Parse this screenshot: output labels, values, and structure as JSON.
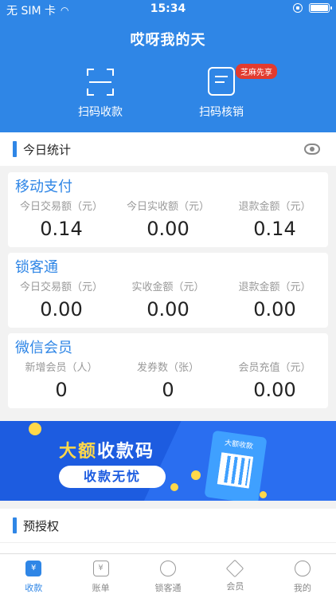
{
  "status": {
    "carrier": "无 SIM 卡",
    "time": "15:34",
    "battery_level": 0.9
  },
  "app_title": "哎呀我的天",
  "actions": {
    "scan_label": "扫码收款",
    "verify_label": "扫码核销",
    "verify_badge": "芝麻先享"
  },
  "today": {
    "header": "今日统计",
    "cards": [
      {
        "title": "移动支付",
        "cols": [
          {
            "label": "今日交易额（元）",
            "value": "0.14"
          },
          {
            "label": "今日实收额（元）",
            "value": "0.00"
          },
          {
            "label": "退款金额（元）",
            "value": "0.14"
          }
        ]
      },
      {
        "title": "锁客通",
        "cols": [
          {
            "label": "今日交易额（元）",
            "value": "0.00"
          },
          {
            "label": "实收金额（元）",
            "value": "0.00"
          },
          {
            "label": "退款金额（元）",
            "value": "0.00"
          }
        ]
      },
      {
        "title": "微信会员",
        "cols": [
          {
            "label": "新增会员（人）",
            "value": "0"
          },
          {
            "label": "发券数（张）",
            "value": "0"
          },
          {
            "label": "会员充值（元）",
            "value": "0.00"
          }
        ]
      }
    ]
  },
  "banner": {
    "title_hl": "大额",
    "title_rest": "收款码",
    "pill": "收款无忧",
    "card_label": "大额收款"
  },
  "preauth": {
    "header": "预授权"
  },
  "tabs": [
    {
      "label": "收款",
      "glyph": "¥"
    },
    {
      "label": "账单",
      "glyph": "¥"
    },
    {
      "label": "锁客通",
      "glyph": ""
    },
    {
      "label": "会员",
      "glyph": ""
    },
    {
      "label": "我的",
      "glyph": ""
    }
  ],
  "colors": {
    "primary": "#2f86e6",
    "badge": "#e23b2f",
    "banner": "#1d5ce0"
  }
}
